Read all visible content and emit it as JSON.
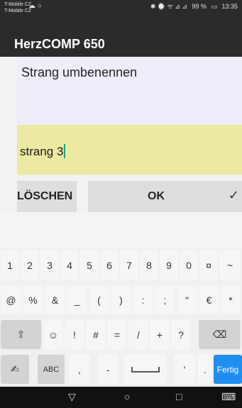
{
  "status_bar": {
    "carrier_1": "T-Mobile CZ",
    "carrier_2": "T-Mobile CZ",
    "icons_left": "☁ ○",
    "icons_right": "✱ ⌚ ᯤ ⊿ ⊿",
    "battery_text": "99 %",
    "time": "13:35"
  },
  "app": {
    "title": "HerzCOMP 650"
  },
  "dialog": {
    "title": "Strang umbenennen",
    "input_value": "strang 3",
    "delete_label": "LÖSCHEN",
    "ok_label": "OK",
    "ok_check": "✓"
  },
  "keyboard": {
    "row1": [
      "1",
      "2",
      "3",
      "4",
      "5",
      "6",
      "7",
      "8",
      "9",
      "0",
      "¤",
      "~"
    ],
    "row2": [
      "@",
      "%",
      "&",
      "_",
      "(",
      ")",
      ":",
      ";",
      "\"",
      "€",
      "*"
    ],
    "row3": [
      "☺",
      "!",
      "#",
      "=",
      "/",
      "+",
      "?"
    ],
    "row3_shift_icon": "⇧",
    "row3_backspace": "⌫",
    "row4_handwriting": "✍",
    "row4_abc": "ABC",
    "row4_comma": ",",
    "row4_dash": "-",
    "row4_apostrophe": "'",
    "row4_period": ".",
    "row4_action": "Fertig"
  },
  "navbar": {
    "back": "▽",
    "home": "○",
    "recent": "□",
    "keyboard": "⌨"
  },
  "colors": {
    "accent": "#1f8ef0",
    "input_bg": "#ece9a2",
    "title_bg": "#eeeefb",
    "appbar_bg": "#2b2b2b",
    "caret": "#18a57a"
  }
}
